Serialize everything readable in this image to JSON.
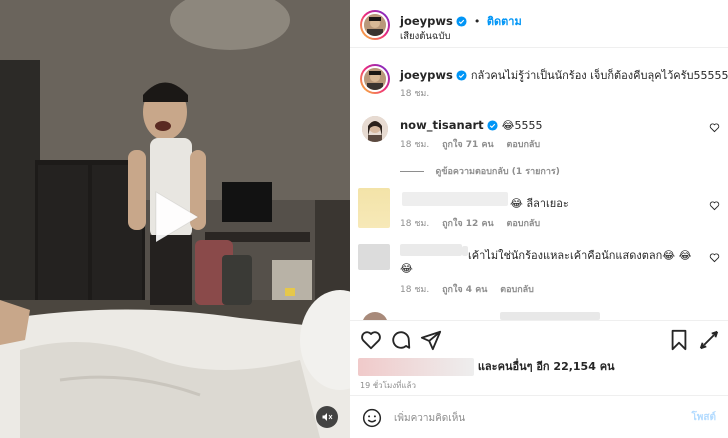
{
  "post": {
    "username": "joeypws",
    "follow_label": "ติดตาม",
    "audio_label": "เสียงต้นฉบับ",
    "caption": "กลัวคนไม่รู้ว่าเป็นนักร้อง เจ็บก็ต้องคีบลุคไว้ครับ555555",
    "caption_time": "18 ชม."
  },
  "comments": [
    {
      "username": "now_tisanart",
      "text": "😂5555",
      "time": "18 ชม.",
      "likes": "ถูกใจ 71 คน",
      "reply_label": "ตอบกลับ",
      "view_replies": "ดูข้อความตอบกลับ (1 รายการ)"
    },
    {
      "text": "😂 ลีลาเยอะ",
      "time": "18 ชม.",
      "likes": "ถูกใจ 12 คน",
      "reply_label": "ตอบกลับ"
    },
    {
      "text": "เค้าไม่ใช่นักร้องแหละเค้าคือนักแสดงตลก😂 😂",
      "text2": "😂",
      "time": "18 ชม.",
      "likes": "ถูกใจ 4 คน",
      "reply_label": "ตอบกลับ"
    }
  ],
  "likes_summary": "และคนอื่นๆ อีก 22,154 คน",
  "post_time": "19 ชั่วโมงที่แล้ว",
  "add_comment": {
    "placeholder": "เพิ่มความคิดเห็น",
    "post_label": "โพสต์"
  },
  "colors": {
    "link_blue": "#0095f6",
    "post_disabled": "#b3dbff",
    "verified": "#0095f6",
    "muted": "#8e8e8e"
  },
  "icons": [
    "play-icon",
    "mute-icon",
    "heart-icon",
    "comment-icon",
    "share-icon",
    "bookmark-icon",
    "more-icon",
    "emoji-icon",
    "verified-icon"
  ]
}
